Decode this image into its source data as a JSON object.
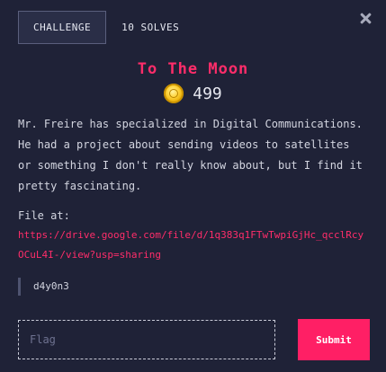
{
  "tabs": {
    "challenge": "CHALLENGE",
    "solves": "10 SOLVES"
  },
  "challenge": {
    "title": "To The Moon",
    "points": "499",
    "description": "Mr. Freire has specialized in Digital Communications. He had a project about sending videos to satellites or something I don't really know about, but I find it pretty fascinating.",
    "file_label": "File at:",
    "file_url": "https://drive.google.com/file/d/1q383q1FTwTwpiGjHc_qcclRcyOCuL4I-/view?usp=sharing",
    "author": "d4y0n3"
  },
  "form": {
    "flag_placeholder": "Flag",
    "submit_label": "Submit"
  },
  "colors": {
    "background": "#1f2237",
    "accent": "#ff2d6a",
    "submit": "#ff1f65"
  },
  "icons": {
    "close": "close-icon",
    "coin": "coin-icon"
  }
}
